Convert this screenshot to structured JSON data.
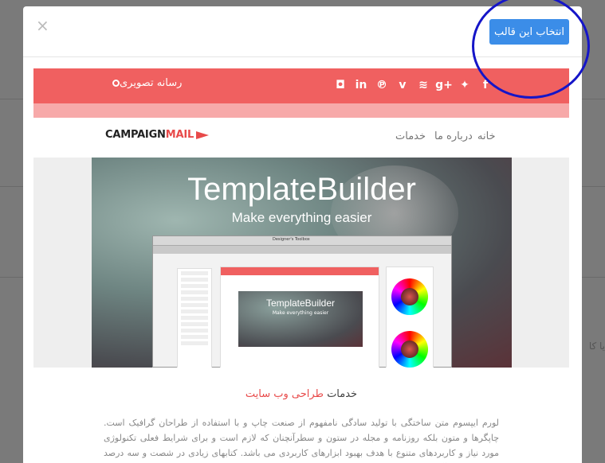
{
  "background": {
    "partial_text": "یا کا"
  },
  "modal": {
    "close_symbol": "×",
    "select_button_label": "انتخاب این قالب"
  },
  "template": {
    "rss_title": "رسانه تصویری",
    "social_icons": [
      "instagram-icon",
      "linkedin-icon",
      "pinterest-icon",
      "vimeo-icon",
      "rss-icon",
      "google-plus-icon",
      "twitter-icon",
      "facebook-icon"
    ],
    "social_glyphs": [
      "◘",
      "in",
      "℗",
      "v",
      "≋",
      "g+",
      "✦",
      "f"
    ],
    "nav": {
      "home": "خانه",
      "about": "درباره ما",
      "services": "خدمات"
    },
    "logo": {
      "part1": "CAMPAIGN",
      "part2": "MAIL"
    },
    "hero": {
      "title": "TemplateBuilder",
      "subtitle": "Make everything easier",
      "inner_title": "TemplateBuilder",
      "inner_subtitle": "Make everything easier",
      "inner_window_title": "Designer's Toolbox"
    },
    "services_label": "خدمات",
    "services_highlight": "طراحی وب سایت",
    "body_text": "لورم ایپسوم متن ساختگی با تولید سادگی نامفهوم از صنعت چاپ و با استفاده از طراحان گرافیک است. چاپگرها و متون بلکه روزنامه و مجله در ستون و سطرآنچنان که لازم است و برای شرایط فعلی تکنولوژی مورد نیاز و کاربردهای متنوع با هدف بهبود ابزارهای کاربردی می باشد. کتابهای زیادی در شصت و سه درصد گذشته، حال و آینده شناخت فراوان جامعه و متخصصان را می طلبد تا با نرم افزارها شناخت"
  },
  "colors": {
    "accent_blue": "#3b8de8",
    "template_red": "#f06060",
    "annotation_circle": "#1515c8"
  }
}
